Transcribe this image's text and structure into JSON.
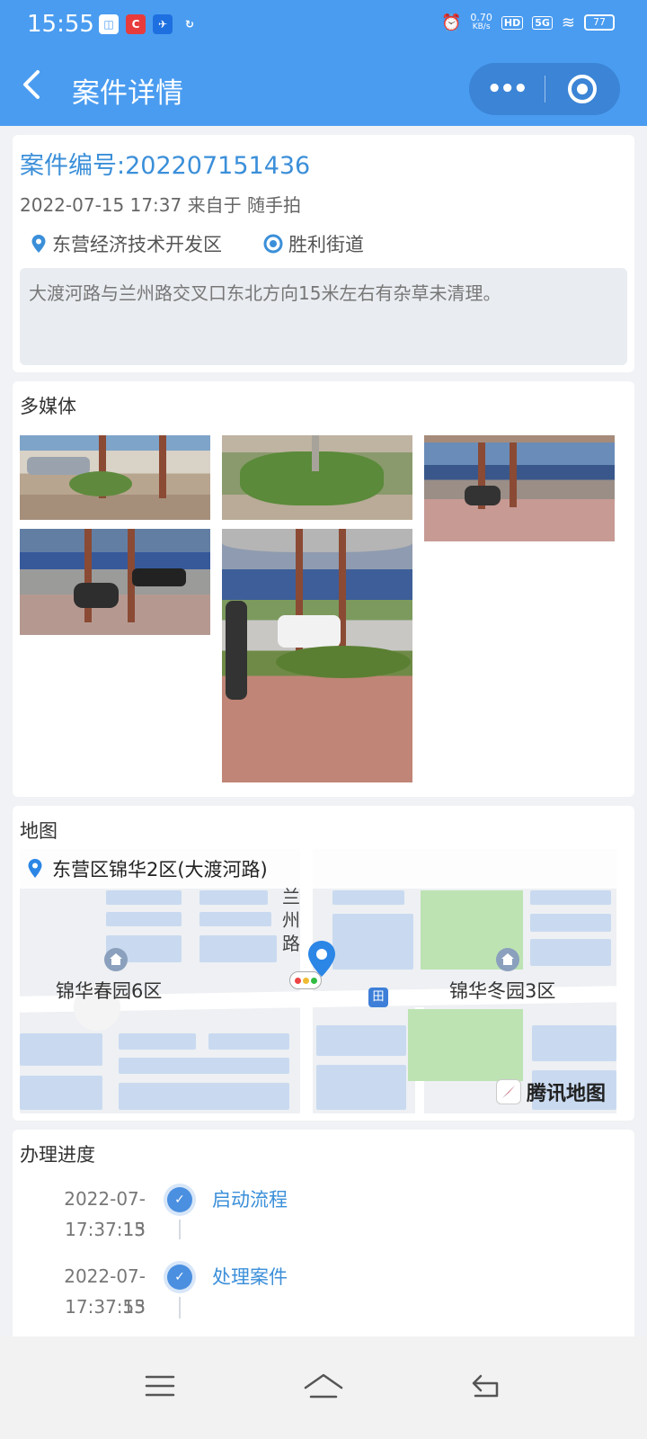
{
  "status_bar": {
    "time": "15:55",
    "net_speed_value": "0.70",
    "net_speed_unit": "KB/s",
    "hd": "HD",
    "signal": "5G",
    "battery": "77"
  },
  "nav": {
    "title": "案件详情",
    "back_icon": "chevron-left-icon",
    "more_icon": "more-dots-icon",
    "close_icon": "target-circle-icon",
    "color": "#4a9cf0"
  },
  "case": {
    "number_label": "案件编号:202207151436",
    "meta": "2022-07-15 17:37 来自于 随手拍",
    "district": "东营经济技术开发区",
    "street": "胜利街道",
    "description": "大渡河路与兰州路交叉口东北方向15米左右有杂草未清理。"
  },
  "media": {
    "title": "多媒体",
    "photos": [
      "photo-1",
      "photo-2",
      "photo-3",
      "photo-4",
      "photo-5"
    ]
  },
  "map": {
    "title": "地图",
    "address": "东营区锦华2区(大渡河路)",
    "road_label": "兰州路",
    "place_left": "锦华春园6区",
    "place_right": "锦华冬园3区",
    "bus_icon": "田",
    "provider": "腾讯地图"
  },
  "progress": {
    "title": "办理进度",
    "steps": [
      {
        "date": "2022-07-15",
        "time": "17:37:13",
        "label": "启动流程"
      },
      {
        "date": "2022-07-15",
        "time": "17:37:53",
        "label": "处理案件"
      }
    ]
  },
  "accent_color": "#3b8fd9"
}
